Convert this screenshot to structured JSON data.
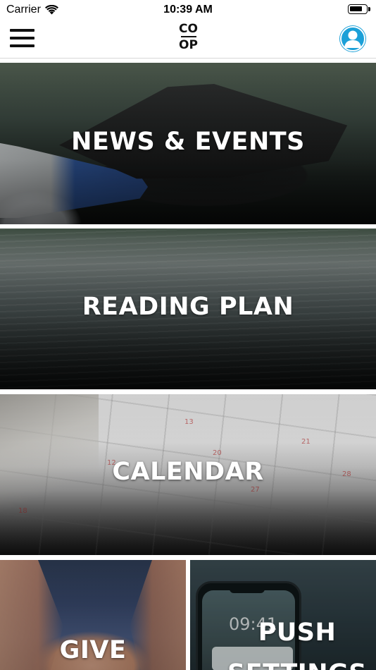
{
  "status_bar": {
    "carrier": "Carrier",
    "time": "10:39 AM",
    "battery_level": 0.65,
    "icons": [
      "wifi-icon",
      "battery-icon"
    ]
  },
  "nav": {
    "menu_icon": "hamburger-menu-icon",
    "logo_top": "CO",
    "logo_bottom": "OP",
    "profile_icon": "user-profile-icon",
    "profile_color": "#1ba0d8"
  },
  "tiles": [
    {
      "label": "NEWS & EVENTS"
    },
    {
      "label": "READING PLAN"
    },
    {
      "label": "CALENDAR"
    },
    {
      "label": "GIVE"
    },
    {
      "label": "PUSH SETTINGS"
    }
  ],
  "calendar_tile": {
    "visible_numbers": [
      "13",
      "20",
      "21",
      "27",
      "28",
      "18",
      "12"
    ]
  },
  "push_tile": {
    "phone_time": "09:41"
  }
}
